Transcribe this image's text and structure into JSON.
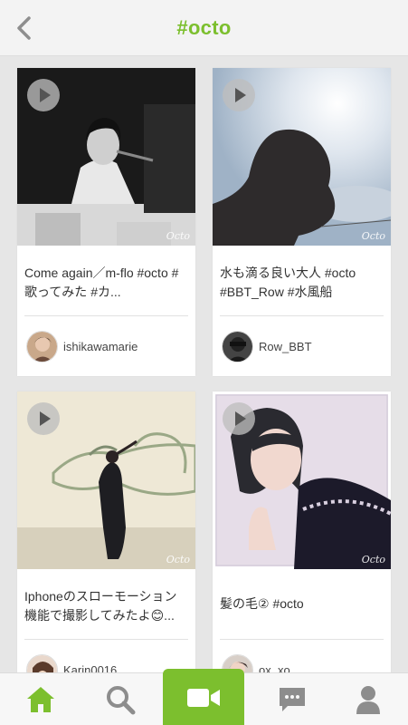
{
  "header": {
    "title": "#octo",
    "back_icon": "chevron-left-icon"
  },
  "accent_color": "#7cbf2e",
  "watermark": "Octo",
  "posts": [
    {
      "caption": "Come again／m-flo #octo #歌ってみた #カ...",
      "username": "ishikawamarie"
    },
    {
      "caption": "水も滴る良い大人 #octo #BBT_Row #水風船",
      "username": "Row_BBT"
    },
    {
      "caption": "Iphoneのスローモーション機能で撮影してみたよ😊...",
      "username": "Karin0016"
    },
    {
      "caption": "髪の毛② #octo",
      "username": "ox_xo"
    }
  ],
  "tabbar": {
    "items": [
      "home-icon",
      "search-icon",
      "video-camera-icon",
      "chat-icon",
      "profile-icon"
    ],
    "active": "home"
  }
}
